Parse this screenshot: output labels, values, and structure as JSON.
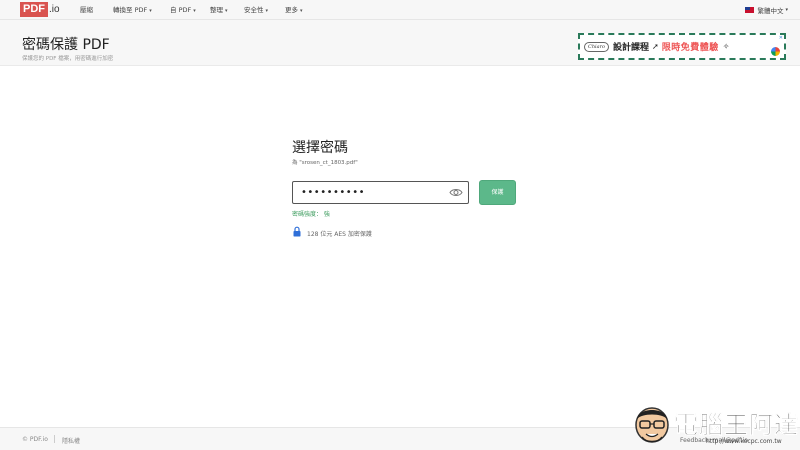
{
  "nav": {
    "logo_main": "PDF",
    "logo_suffix": ".io",
    "items": [
      {
        "label": "壓縮",
        "caret": ""
      },
      {
        "label": "轉換至 PDF",
        "caret": "▾"
      },
      {
        "label": "自 PDF",
        "caret": "▾"
      },
      {
        "label": "整理",
        "caret": "▾"
      },
      {
        "label": "安全性",
        "caret": "▾"
      },
      {
        "label": "更多",
        "caret": "▾"
      }
    ],
    "language": "繁體中文",
    "language_caret": "▾"
  },
  "header": {
    "title": "密碼保護 PDF",
    "subtitle": "保護您的 PDF 檔案，用密碼進行加密"
  },
  "ad": {
    "badge": "Chiaro",
    "title": "設計課程",
    "promo": "限時免費體驗",
    "close": "✕"
  },
  "form": {
    "title": "選擇密碼",
    "file_note": "為 \"srosen_ct_1803.pdf\"",
    "password_value": "••••••••••",
    "protect_label": "保護",
    "strength_text": "密碼強度： 強",
    "aes_note": "128 位元 AES 加密保護"
  },
  "footer": {
    "copyright": "© PDF.io",
    "privacy": "隱私權",
    "feedback": "Feedback: mail@pdf.io"
  },
  "watermark": {
    "text": "電腦王阿達",
    "url": "http://www.kocpc.com.tw"
  },
  "colors": {
    "accent_green": "#5cb88a",
    "strength_green": "#3a9b5c",
    "logo_red": "#d9534f",
    "lock_blue": "#2f6fd8"
  }
}
